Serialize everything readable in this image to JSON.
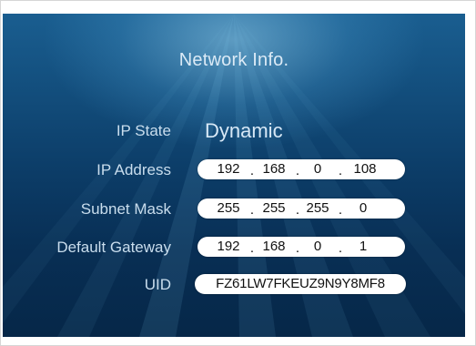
{
  "title": "Network Info.",
  "rows": {
    "ip_state": {
      "label": "IP State",
      "value": "Dynamic"
    },
    "ip_address": {
      "label": "IP Address",
      "octets": [
        "192",
        "168",
        "0",
        "108"
      ]
    },
    "subnet_mask": {
      "label": "Subnet Mask",
      "octets": [
        "255",
        "255",
        "255",
        "0"
      ]
    },
    "default_gateway": {
      "label": "Default Gateway",
      "octets": [
        "192",
        "168",
        "0",
        "1"
      ]
    },
    "uid": {
      "label": "UID",
      "value": "FZ61LW7FKEUZ9N9Y8MF8"
    }
  },
  "separator": ".",
  "colors": {
    "background_top": "#1a5e90",
    "background_bottom": "#062748",
    "label_text": "#c9dded",
    "field_background": "#ffffff",
    "field_text": "#111111"
  }
}
